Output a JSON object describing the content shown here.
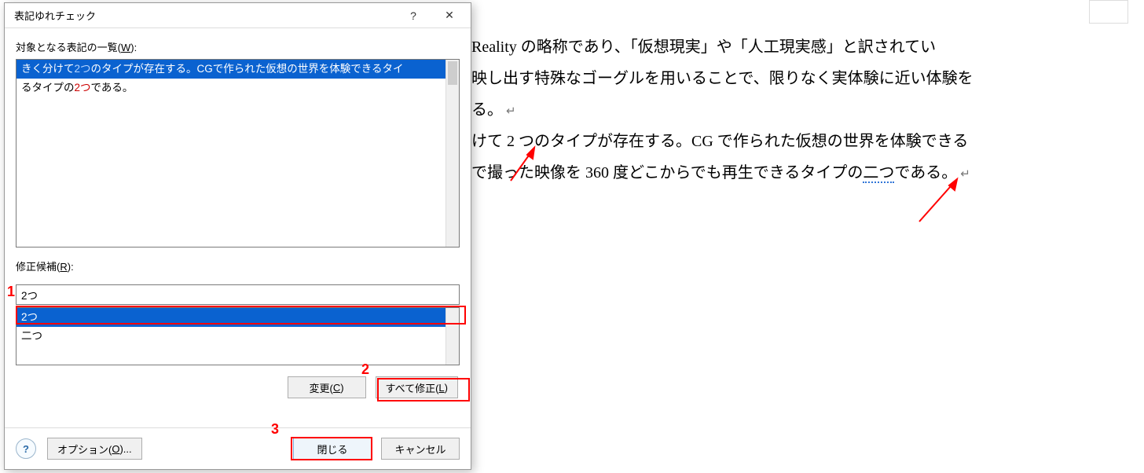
{
  "dialog": {
    "title": "表記ゆれチェック",
    "help_glyph": "?",
    "close_glyph": "✕",
    "list_label_pre": "対象となる表記の一覧(",
    "list_label_key": "W",
    "list_label_post": "):",
    "list_row": {
      "seg1": "きく分けて",
      "seg2": "2つ",
      "seg3": "のタイプが存在する。CGで作られた仮想の世界を体験できるタイ",
      "wrap1": "るタイプの",
      "wrap2": "2つ",
      "wrap3": "である。"
    },
    "cand_label_pre": "修正候補(",
    "cand_label_key": "R",
    "cand_label_post": "):",
    "cand_value": "2つ",
    "cand_options": [
      "2つ",
      "二つ"
    ],
    "btn_change_pre": "変更(",
    "btn_change_key": "C",
    "btn_change_post": ")",
    "btn_fixall_pre": "すべて修正(",
    "btn_fixall_key": "L",
    "btn_fixall_post": ")",
    "help_icon": "?",
    "btn_options_pre": "オプション(",
    "btn_options_key": "O",
    "btn_options_post": ")...",
    "btn_close": "閉じる",
    "btn_cancel": "キャンセル"
  },
  "doc": {
    "line1": "Reality の略称であり、「仮想現実」や「人工現実感」と訳されてい",
    "line2": "映し出す特殊なゴーグルを用いることで、限りなく実体験に近い体験を",
    "line3a": "る。",
    "line4": "けて 2 つのタイプが存在する。CG で作られた仮想の世界を体験できる",
    "line5a": "で撮った映像を 360 度どこからでも再生できるタイプの",
    "line5b": "二つ",
    "line5c": "である。"
  },
  "annotations": {
    "num1": "1",
    "num2": "2",
    "num3": "3"
  }
}
